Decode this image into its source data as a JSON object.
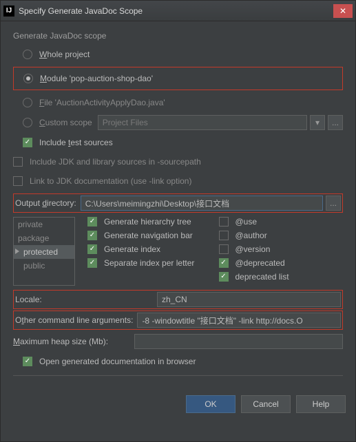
{
  "window": {
    "icon_letters": "IJ",
    "title": "Specify Generate JavaDoc Scope"
  },
  "group_label": "Generate JavaDoc scope",
  "scope": {
    "whole_prefix": "W",
    "whole_rest": "hole project",
    "module_prefix": "M",
    "module_rest": "odule 'pop-auction-shop-dao'",
    "file_prefix": "F",
    "file_rest": "ile 'AuctionActivityApplyDao.java'",
    "custom_prefix": "C",
    "custom_rest": "ustom scope",
    "custom_value": "Project Files",
    "include_test_prefix": "Include ",
    "include_test_u": "t",
    "include_test_suffix": "est sources",
    "include_jdk": "Include JDK and library sources in -sourcepath",
    "link_jdk": "Link to JDK documentation (use -link option)"
  },
  "output": {
    "label_pre": "Output ",
    "label_u": "d",
    "label_post": "irectory:",
    "value": "C:\\Users\\meimingzhi\\Desktop\\接口文档",
    "browse": "..."
  },
  "visibility": {
    "private": "private",
    "package": "package",
    "protected": "protected",
    "public": "public"
  },
  "gen": {
    "hierarchy": "Generate hierarchy tree",
    "nav": "Generate navigation bar",
    "index": "Generate index",
    "separate": "Separate index per letter",
    "use": "@use",
    "author": "@author",
    "version": "@version",
    "deprecated": "@deprecated",
    "deplist": "deprecated list"
  },
  "locale": {
    "label": "Locale:",
    "value": "zh_CN"
  },
  "args": {
    "label_pre": "O",
    "label_u": "t",
    "label_post": "her command line arguments:",
    "value": "-8 -windowtitle \"接口文档\" -link http://docs.O"
  },
  "heap": {
    "label_pre": "",
    "label_u": "M",
    "label_post": "aximum heap size (Mb):",
    "value": ""
  },
  "open_in_browser": "Open generated documentation in browser",
  "buttons": {
    "ok": "OK",
    "cancel": "Cancel",
    "help": "Help"
  }
}
